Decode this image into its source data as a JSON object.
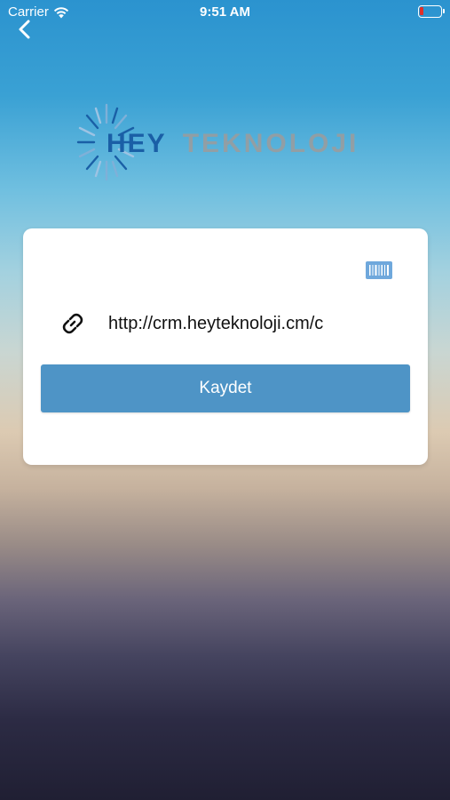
{
  "status_bar": {
    "carrier": "Carrier",
    "time": "9:51 AM",
    "wifi_icon": "wifi-icon",
    "battery_icon": "battery-low-icon",
    "battery_color": "#e0302a"
  },
  "nav": {
    "back_icon": "chevron-left-icon"
  },
  "logo": {
    "text_primary": "HEY",
    "text_secondary": "TEKNOLOJI",
    "primary_color": "#1a5fa6",
    "secondary_color": "#9c9c9c"
  },
  "form": {
    "barcode_icon": "barcode-scan-icon",
    "link_icon": "link-icon",
    "url_value": "http://crm.heyteknoloji.cm/c",
    "save_label": "Kaydet",
    "button_color": "#4e94c6"
  }
}
